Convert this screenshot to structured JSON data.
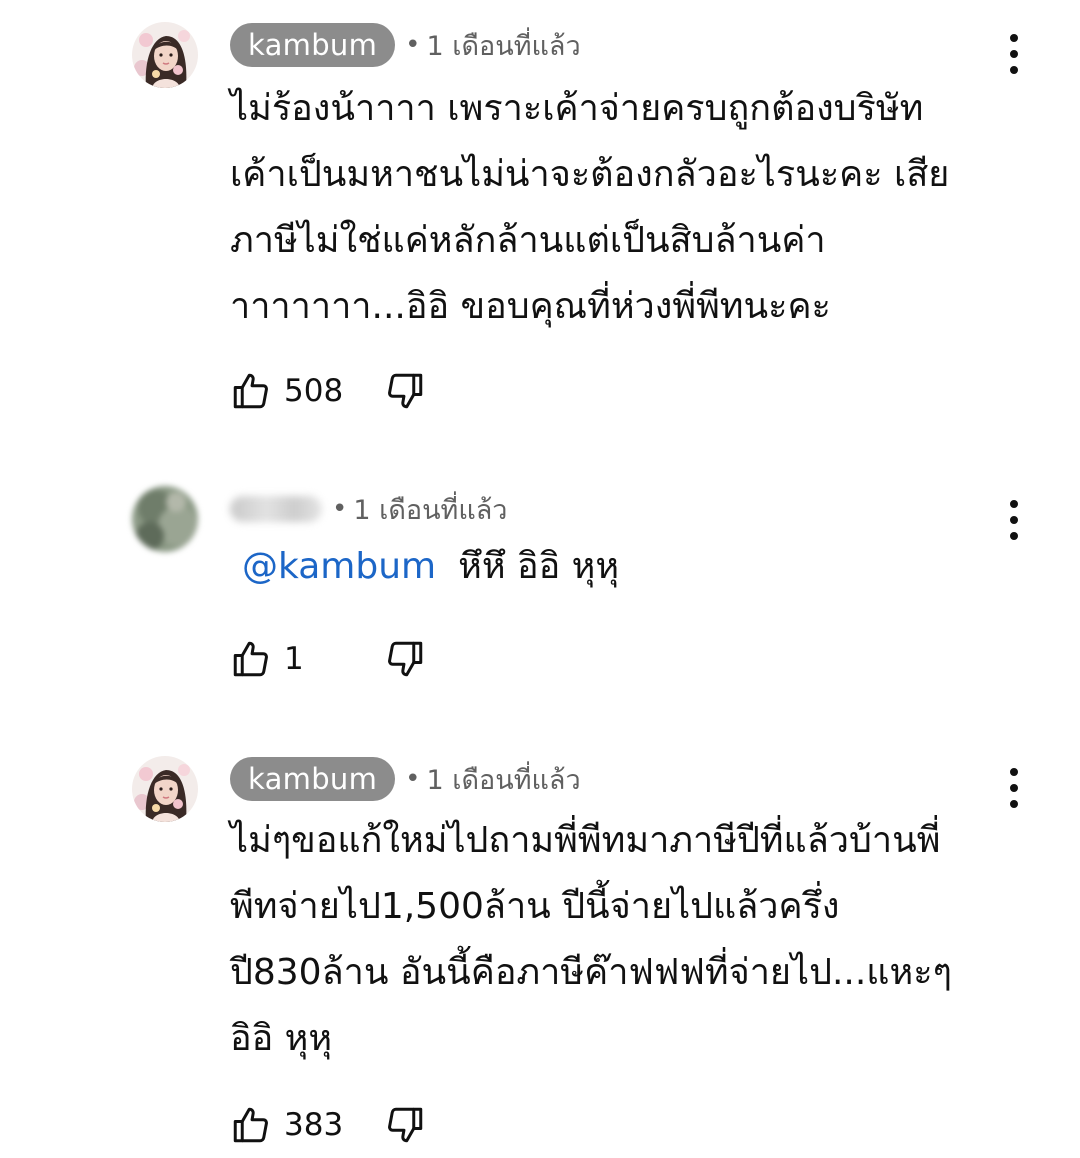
{
  "comments": [
    {
      "author": "kambum",
      "time": "1 เดือนที่แล้ว",
      "lines": [
        "ไม่ร้องน้าาาา เพราะเค้าจ่ายครบถูกต้องบริษัท",
        "เค้าเป็นมหาชนไม่น่าจะต้องกลัวอะไรนะคะ เสีย",
        "ภาษีไม่ใช่แค่หลักล้านแต่เป็นสิบล้านค่า",
        "าาาาาาา...อิอิ ขอบคุณที่ห่วงพี่พีทนะคะ"
      ],
      "likes": "508"
    },
    {
      "author": "",
      "time": "1 เดือนที่แล้ว",
      "mention": "@kambum",
      "text": "หึหึ อิอิ หุหุ",
      "likes": "1"
    },
    {
      "author": "kambum",
      "time": "1 เดือนที่แล้ว",
      "lines": [
        "ไม่ๆขอแก้ใหม่ไปถามพี่พีทมาภาษีปีที่แล้วบ้านพี่",
        "พีทจ่ายไป1,500ล้าน ปีนี้จ่ายไปแล้วครึ่ง",
        "ปี830ล้าน อันนี้คือภาษีค๊าฟฟฟที่จ่ายไป...แหะๆ",
        "อิอิ หุหุ"
      ],
      "likes": "383"
    }
  ],
  "icons": {
    "like": "thumbs-up-outline",
    "dislike": "thumbs-down-outline",
    "menu": "more-vertical"
  },
  "colors": {
    "author_chip": "#8c8c8c",
    "mention": "#1c66c7",
    "meta": "#606060"
  }
}
